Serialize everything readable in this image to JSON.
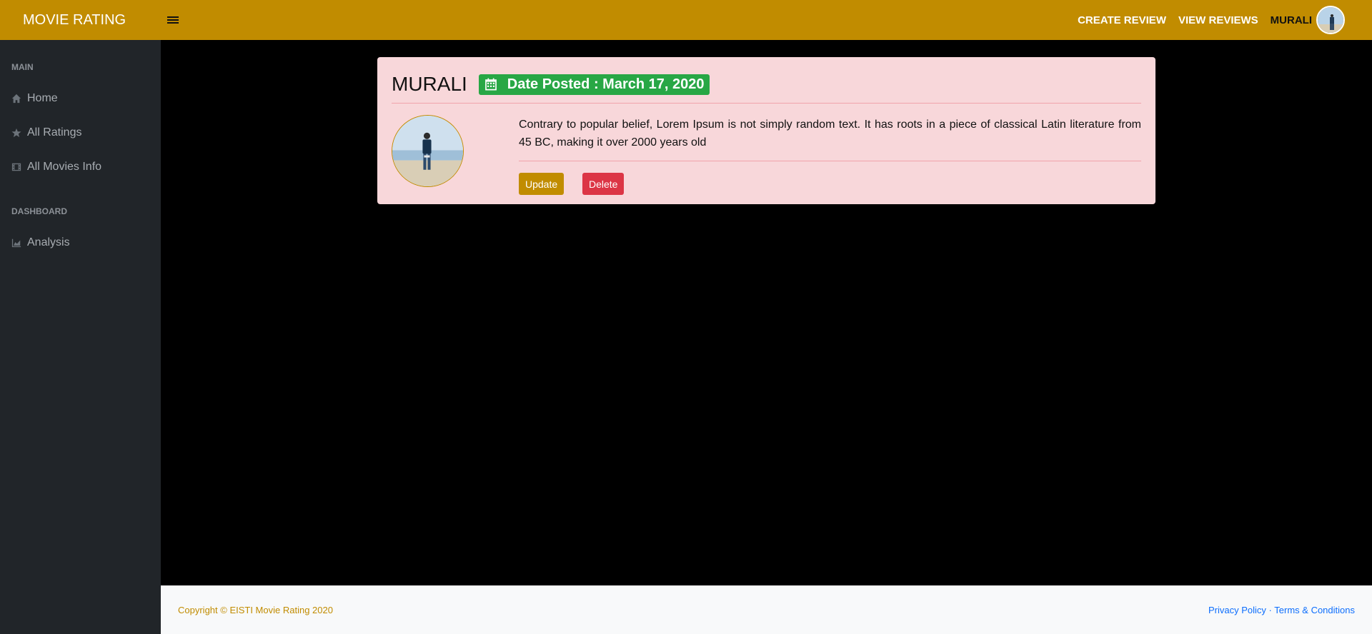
{
  "brand": "MOVIE RATING",
  "nav": {
    "create_review": "CREATE REVIEW",
    "view_reviews": "VIEW REVIEWS",
    "user": "MURALI"
  },
  "sidebar": {
    "heading_main": "MAIN",
    "items_main": [
      {
        "label": "Home",
        "icon": "home-icon"
      },
      {
        "label": "All Ratings",
        "icon": "star-icon"
      },
      {
        "label": "All Movies Info",
        "icon": "film-icon"
      }
    ],
    "heading_dashboard": "DASHBOARD",
    "items_dashboard": [
      {
        "label": "Analysis",
        "icon": "area-chart-icon"
      }
    ]
  },
  "review": {
    "user": "MURALI",
    "date_posted": "Date Posted : March 17, 2020",
    "text": "Contrary to popular belief, Lorem Ipsum is not simply random text. It has roots in a piece of classical Latin literature from 45 BC, making it over 2000 years old",
    "update_label": "Update",
    "delete_label": "Delete"
  },
  "footer": {
    "copyright": "Copyright © EISTI Movie Rating 2020",
    "privacy": "Privacy Policy",
    "separator": "·",
    "terms": "Terms & Conditions"
  },
  "colors": {
    "brand": "#c18c00",
    "sidebar": "#212529",
    "card": "#f8d7da",
    "badge": "#28a745",
    "danger": "#dc3545"
  }
}
